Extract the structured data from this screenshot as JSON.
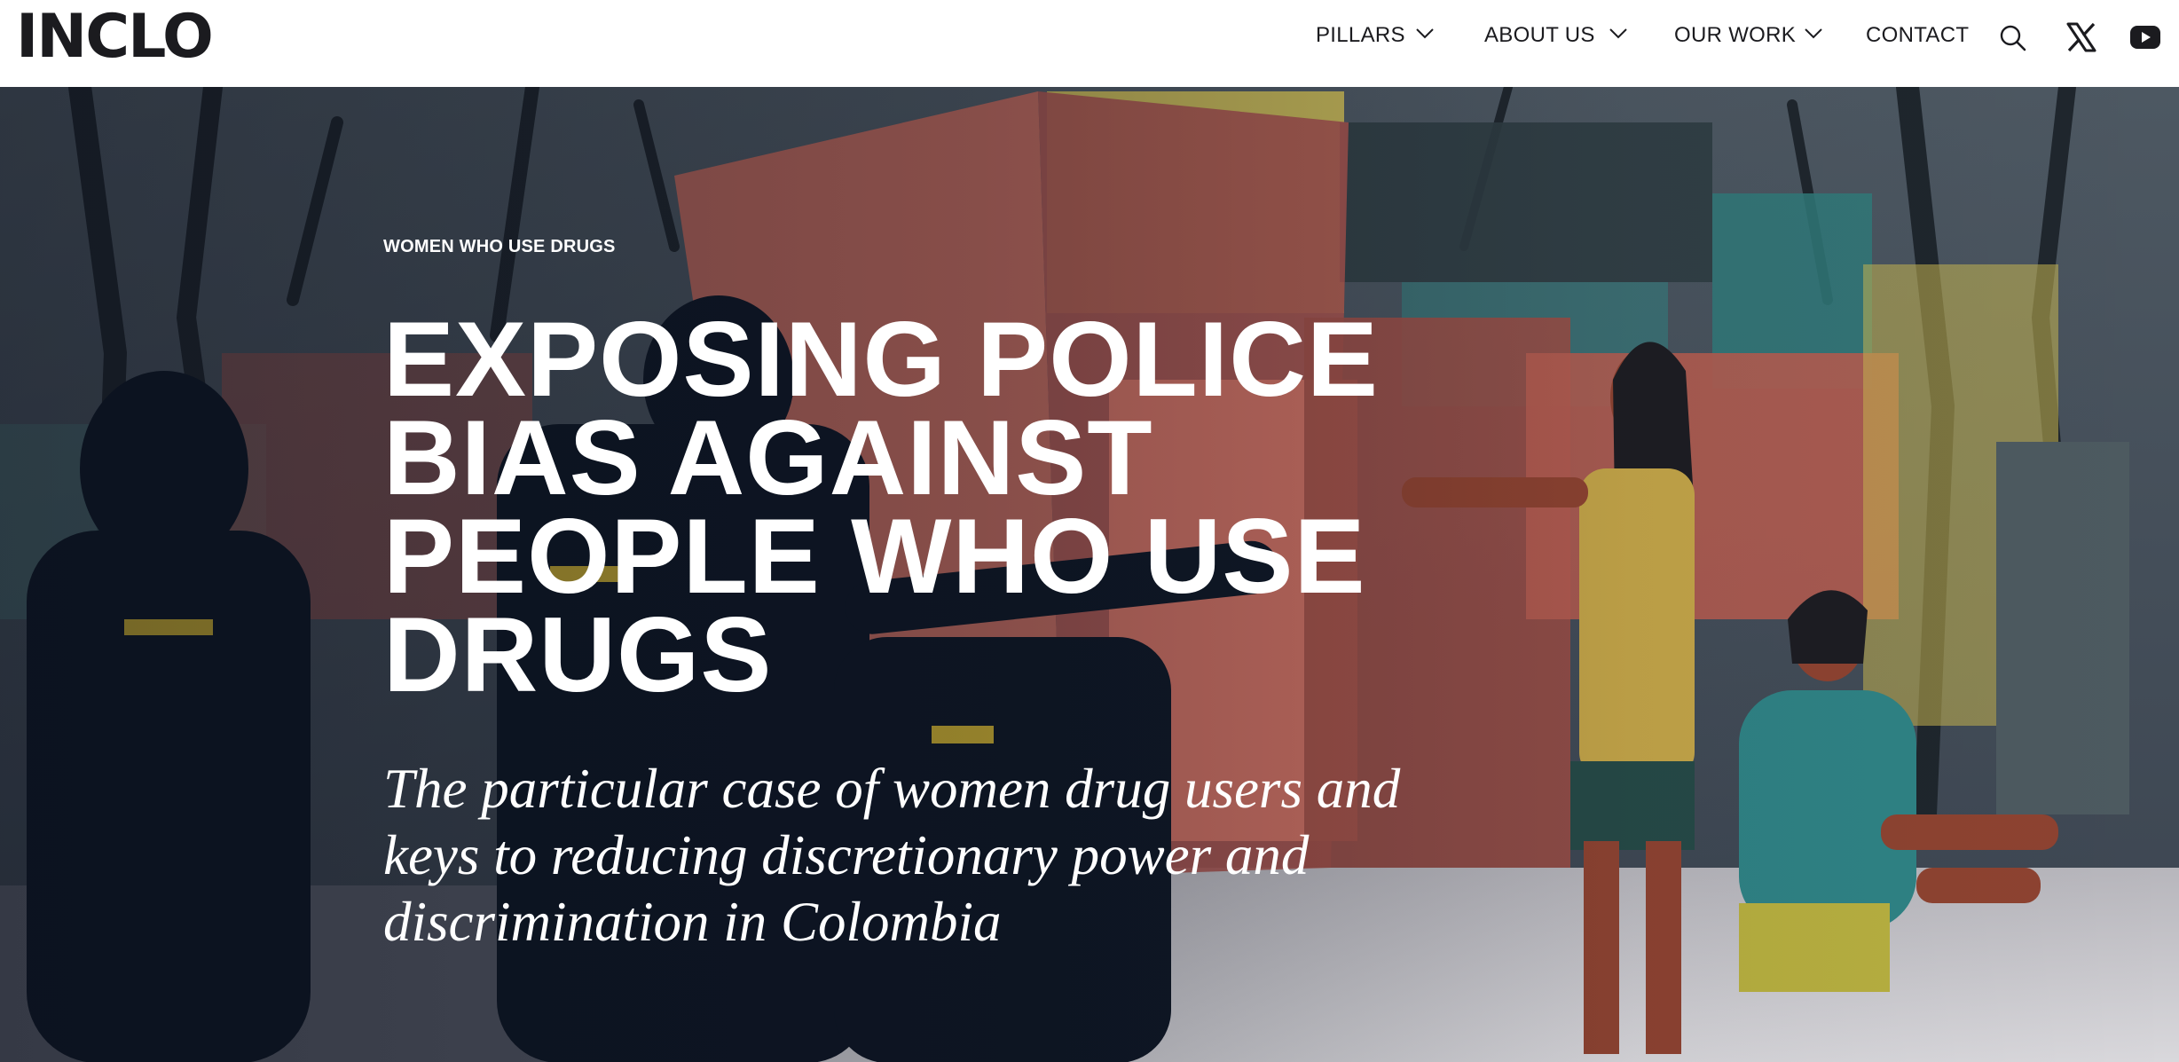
{
  "header": {
    "logo": "INCLO",
    "nav": [
      {
        "label": "PILLARS",
        "has_dropdown": true
      },
      {
        "label": "ABOUT US",
        "has_dropdown": true
      },
      {
        "label": "OUR WORK",
        "has_dropdown": true
      },
      {
        "label": "CONTACT",
        "has_dropdown": false
      }
    ],
    "icons": [
      "search-icon",
      "x-twitter-icon",
      "youtube-icon"
    ]
  },
  "hero": {
    "eyebrow": "WOMEN WHO USE DRUGS",
    "title": "EXPOSING POLICE BIAS AGAINST PEOPLE WHO USE DRUGS",
    "subtitle": "The particular case of women drug users and keys to reducing discretionary power and discrimination in Colombia"
  },
  "colors": {
    "text_dark": "#1b1b1f",
    "header_bg": "#ffffff",
    "hero_text": "#ffffff"
  }
}
